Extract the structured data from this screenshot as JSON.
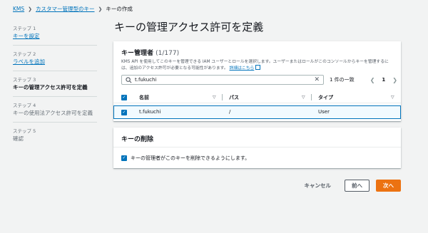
{
  "breadcrumb": {
    "root": "KMS",
    "parent": "カスタマー管理型のキー",
    "current": "キーの作成"
  },
  "steps": [
    {
      "num": "ステップ 1",
      "label": "キーを設定",
      "state": "link"
    },
    {
      "num": "ステップ 2",
      "label": "ラベルを追加",
      "state": "link"
    },
    {
      "num": "ステップ 3",
      "label": "キーの管理アクセス許可を定義",
      "state": "active"
    },
    {
      "num": "ステップ 4",
      "label": "キーの使用法アクセス許可を定義",
      "state": "muted"
    },
    {
      "num": "ステップ 5",
      "label": "確認",
      "state": "muted"
    }
  ],
  "page_title": "キーの管理アクセス許可を定義",
  "admins": {
    "title": "キー管理者",
    "count": "(1/177)",
    "description": "KMS API を使用してこのキーを管理できる IAM ユーザーとロールを選択します。ユーザーまたはロールがこのコンソールからキーを管理するには、追加のアクセス許可が必要となる可能性があります。",
    "learn_more": "詳細はこちら",
    "search_value": "t.fukuchi",
    "match_text": "1 件の一致",
    "page_number": "1",
    "columns": {
      "name": "名前",
      "path": "パス",
      "type": "タイプ"
    },
    "rows": [
      {
        "name": "t.fukuchi",
        "path": "/",
        "type": "User",
        "selected": true
      }
    ]
  },
  "deletion": {
    "title": "キーの削除",
    "checkbox_label": "キーの管理者がこのキーを削除できるようにします。",
    "checked": true
  },
  "buttons": {
    "cancel": "キャンセル",
    "previous": "前へ",
    "next": "次へ"
  },
  "colors": {
    "accent": "#ec7211",
    "link": "#0073bb",
    "selected_row_bg": "#f1faff"
  }
}
